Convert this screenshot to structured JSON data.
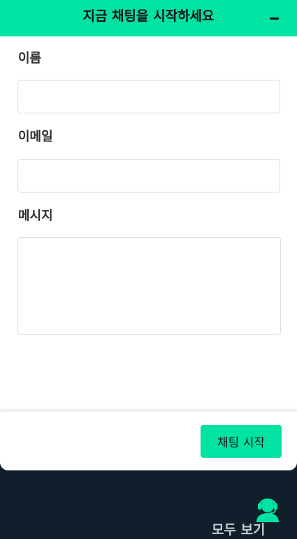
{
  "header": {
    "title": "지금 채팅을 시작하세요",
    "minimize_icon": "minimize-icon"
  },
  "form": {
    "name_label": "이름",
    "name_value": "",
    "email_label": "이메일",
    "email_value": "",
    "message_label": "메시지",
    "message_value": ""
  },
  "footer": {
    "start_button_label": "채팅 시작"
  },
  "launcher": {
    "icon": "headset-agent-icon",
    "view_all_label": "모두 보기"
  },
  "colors": {
    "accent": "#01e3a3",
    "background_dark": "#111f2d",
    "panel": "#ffffff",
    "text": "#2b2f33",
    "input_border": "#d9dcdf"
  }
}
